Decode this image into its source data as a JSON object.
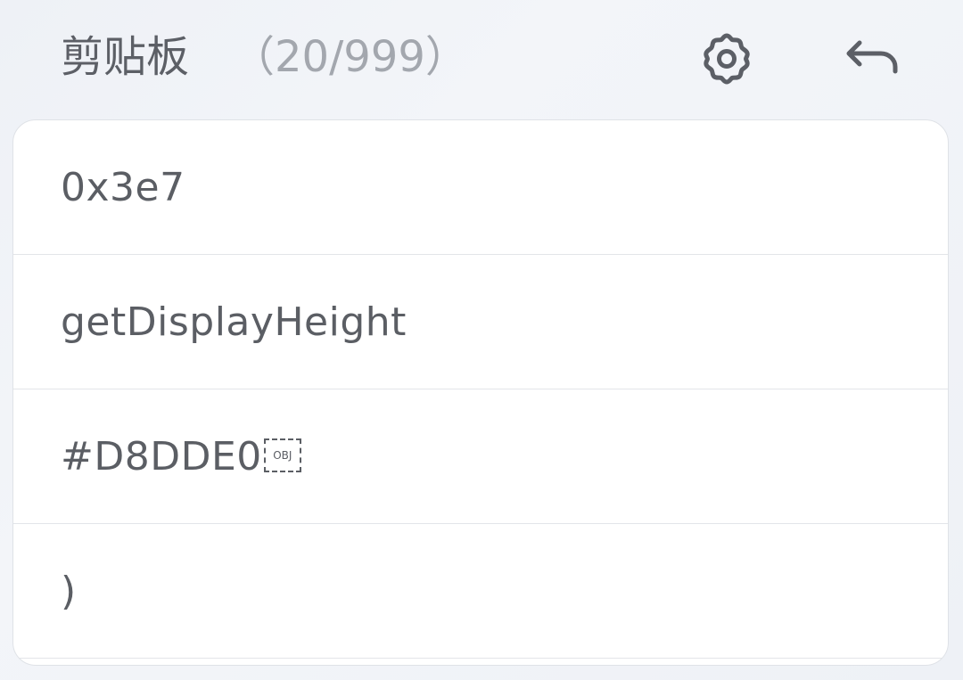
{
  "header": {
    "title": "剪贴板",
    "count": "（20/999）",
    "settings_icon": "gear-icon",
    "back_icon": "undo-arrow-icon"
  },
  "clipboard": {
    "items": [
      {
        "text": "0x3e7"
      },
      {
        "text": "getDisplayHeight"
      },
      {
        "text": "#D8DDE0",
        "suffix": "OBJ"
      },
      {
        "text": ")"
      }
    ]
  },
  "colors": {
    "background": "#eef1f6",
    "card": "#ffffff",
    "text": "#5b5e64",
    "muted_text": "#a3a7ae",
    "divider": "#e3e5e9"
  }
}
